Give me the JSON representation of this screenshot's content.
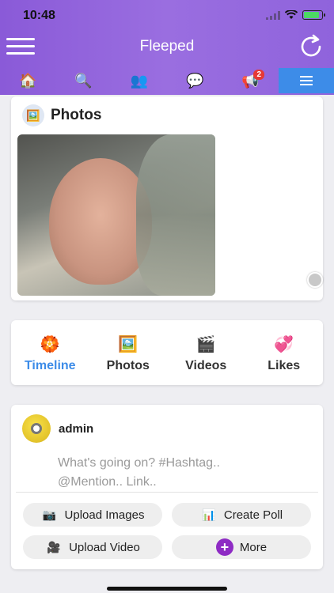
{
  "status_bar": {
    "time": "10:48"
  },
  "header": {
    "title": "Fleeped"
  },
  "top_tabs": [
    {
      "icon": "home-icon",
      "glyph": "🏠"
    },
    {
      "icon": "search-icon",
      "glyph": "🔍"
    },
    {
      "icon": "friends-icon",
      "glyph": "👥"
    },
    {
      "icon": "messages-icon",
      "glyph": "💬"
    },
    {
      "icon": "notifications-icon",
      "glyph": "📢",
      "badge": "2"
    },
    {
      "icon": "menu-icon",
      "glyph": ""
    }
  ],
  "photos_card": {
    "title": "Photos"
  },
  "profile_tabs": [
    {
      "label": "Timeline",
      "icon": "timeline-icon",
      "glyph": "🏵️",
      "active": true
    },
    {
      "label": "Photos",
      "icon": "photos-icon",
      "glyph": "🖼️",
      "active": false
    },
    {
      "label": "Videos",
      "icon": "videos-icon",
      "glyph": "🎬",
      "active": false
    },
    {
      "label": "Likes",
      "icon": "likes-icon",
      "glyph": "💞",
      "active": false
    }
  ],
  "composer": {
    "username": "admin",
    "placeholder_line1": "What's going on? #Hashtag..",
    "placeholder_line2": "@Mention.. Link..",
    "actions": {
      "upload_images": "Upload Images",
      "create_poll": "Create Poll",
      "upload_video": "Upload Video",
      "more": "More"
    }
  },
  "colors": {
    "header": "#8a5ad8",
    "accent": "#3d8ce8",
    "badge": "#e53935",
    "more": "#8e2bc4"
  }
}
